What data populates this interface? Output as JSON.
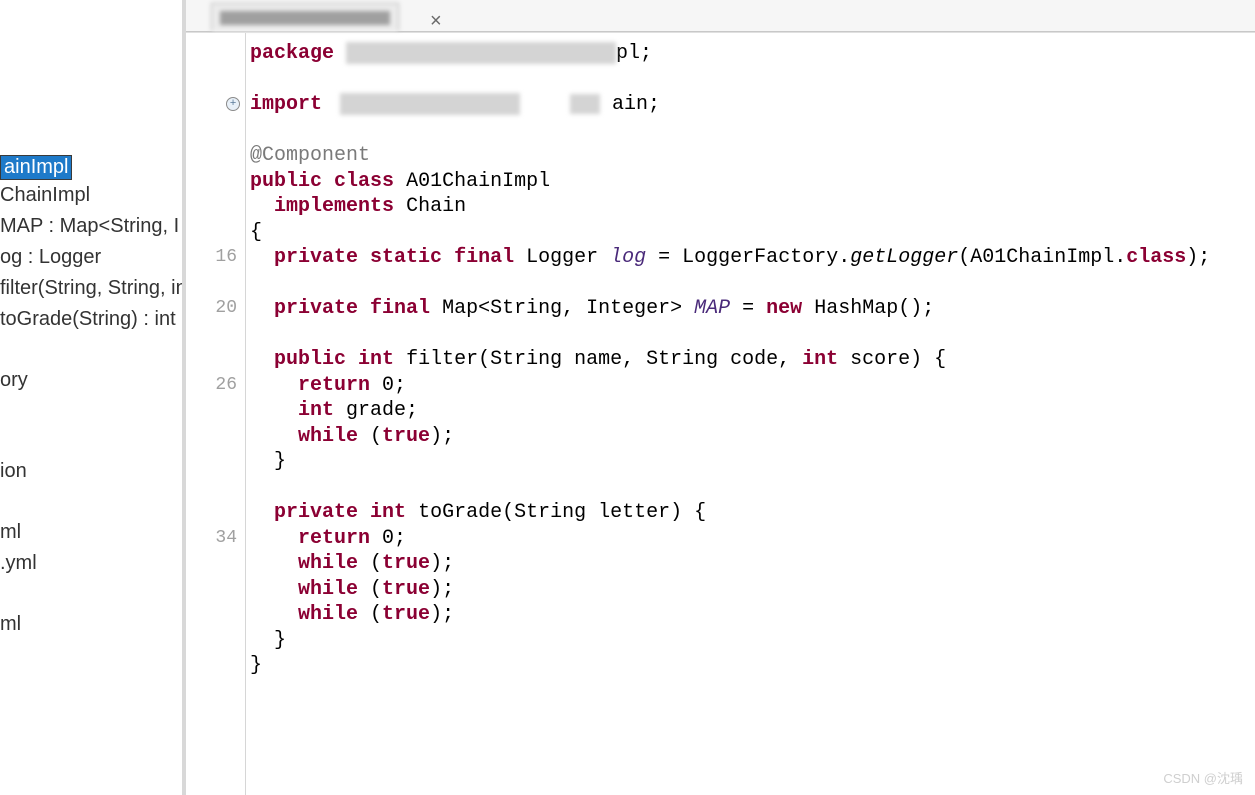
{
  "sidebar": {
    "items": [
      {
        "label": "ainImpl",
        "selected": true
      },
      {
        "label": "ChainImpl"
      },
      {
        "label": "MAP : Map<String, I"
      },
      {
        "label": "og : Logger"
      },
      {
        "label": "filter(String, String, in"
      },
      {
        "label": "toGrade(String) : int"
      }
    ],
    "group2": [
      {
        "label": "ory"
      }
    ],
    "group3": [
      {
        "label": "ion"
      }
    ],
    "group4": [
      {
        "label": "ml"
      },
      {
        "label": ".yml"
      }
    ],
    "group5": [
      {
        "label": "ml"
      }
    ]
  },
  "tab": {
    "close": "×"
  },
  "gutter": {
    "fold_plus": "+",
    "line16": "16",
    "line20": "20",
    "line26": "26",
    "line34": "34"
  },
  "code": {
    "package_kw": "package",
    "package_suffix": "pl;",
    "import_kw": "import",
    "import_suffix": "ain;",
    "annotation": "@Component",
    "public_kw": "public",
    "class_kw": "class",
    "class_name": "A01ChainImpl",
    "implements_kw": "implements",
    "impl_name": "Chain",
    "brace_open": "{",
    "private_kw": "private",
    "static_kw": "static",
    "final_kw": "final",
    "logger_type": "Logger",
    "log_field": "log",
    "eq": " = ",
    "loggerfactory": "LoggerFactory.",
    "getlogger": "getLogger",
    "getlogger_args": "(A01ChainImpl.",
    "class_kw2": "class",
    "getlogger_end": ");",
    "map_type": "Map<String, Integer>",
    "map_field": "MAP",
    "new_kw": "new",
    "hashmap": " HashMap();",
    "int_kw": "int",
    "filter_name": " filter",
    "filter_sig_open": "(String name, String code, ",
    "filter_sig_close": " score) {",
    "return_kw": "return",
    "return_0": " 0;",
    "grade_decl": " grade;",
    "while_kw": "while",
    "true_kw": "true",
    "while_close": ");",
    "brace_close_indent": "  }",
    "tograde_name": " toGrade",
    "tograde_sig": "(String letter) {",
    "brace_close": "}",
    "space_open": " ("
  },
  "watermark": "CSDN @沈瑀"
}
